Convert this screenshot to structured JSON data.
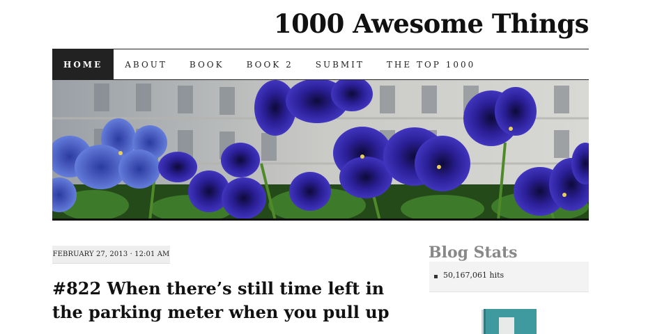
{
  "site": {
    "title": "1000 Awesome Things"
  },
  "nav": {
    "items": [
      {
        "label": "HOME",
        "active": true
      },
      {
        "label": "ABOUT",
        "active": false
      },
      {
        "label": "BOOK",
        "active": false
      },
      {
        "label": "BOOK 2",
        "active": false
      },
      {
        "label": "SUBMIT",
        "active": false
      },
      {
        "label": "THE TOP 1000",
        "active": false
      }
    ]
  },
  "header_image": {
    "subject": "purple pansies in front of a building"
  },
  "post": {
    "date": "FEBRUARY 27, 2013 · 12:01 AM",
    "title": "#822 When there’s still time left in the parking meter when you pull up"
  },
  "sidebar": {
    "blog_stats": {
      "title": "Blog Stats",
      "hits": "50,167,061 hits"
    }
  },
  "colors": {
    "nav_active_bg": "#222222",
    "pansy_purple": "#3a2fb0",
    "book_teal": "#3f9aa0"
  }
}
